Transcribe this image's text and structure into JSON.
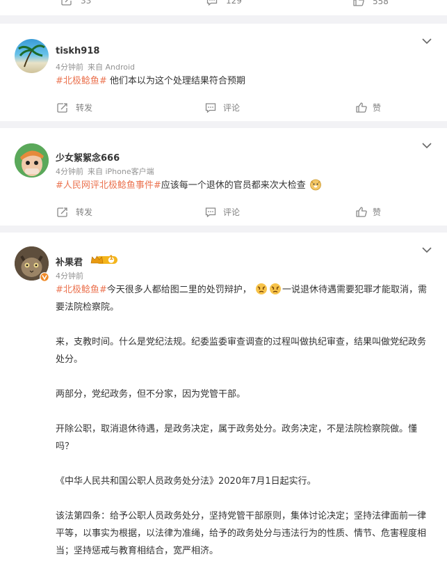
{
  "top_bar": {
    "repost_count": "33",
    "comment_count": "129",
    "like_count": "558"
  },
  "posts": [
    {
      "username": "tiskh918",
      "time": "4分钟前",
      "source": "来自 Android",
      "hashtag": "#北极鲶鱼#",
      "text": " 他们本以为这个处理结果符合预期",
      "repost_label": "转发",
      "comment_label": "评论",
      "like_label": "赞"
    },
    {
      "username": "少女絮絮念666",
      "time": "4分钟前",
      "source": "来自 iPhone客户端",
      "hashtag": "#人民网评北极鲶鱼事件#",
      "text": "应该每一个退休的官员都来次大检查",
      "repost_label": "转发",
      "comment_label": "评论",
      "like_label": "赞"
    },
    {
      "username": "补果君",
      "badge_level": "1",
      "time": "4分钟前",
      "hashtag": "#北极鲶鱼#",
      "text_head": "今天很多人都给图二里的处罚辩护，",
      "text_tail": "一说退休待遇需要犯罪才能取消，需要法院检察院。",
      "paragraphs": [
        "来，支教时间。什么是党纪法规。纪委监委审查调查的过程叫做执纪审查，结果叫做党纪政务处分。",
        "两部分，党纪政务，但不分家，因为党管干部。",
        "开除公职，取消退休待遇，是政务决定，属于政务处分。政务决定，不是法院检察院做。懂吗？",
        "《中华人民共和国公职人员政务处分法》2020年7月1日起实行。",
        "该法第四条：给予公职人员政务处分，坚持党管干部原则，集体讨论决定；坚持法律面前一律平等，以事实为根据，以法律为准绳，给予的政务处分与违法行为的性质、情节、危害程度相当；坚持惩戒与教育相结合，宽严相济。"
      ]
    }
  ],
  "icons": {
    "repost": "repost-icon",
    "comment": "comment-icon",
    "like": "like-icon",
    "more": "chevron-down-icon",
    "verified": "verified-badge-icon",
    "crown": "crown-badge-icon"
  },
  "colors": {
    "hashtag": "#eb7350",
    "meta": "#939393",
    "action": "#808080",
    "badge": "#f4b51c",
    "page_bg": "#f2f2f5"
  }
}
